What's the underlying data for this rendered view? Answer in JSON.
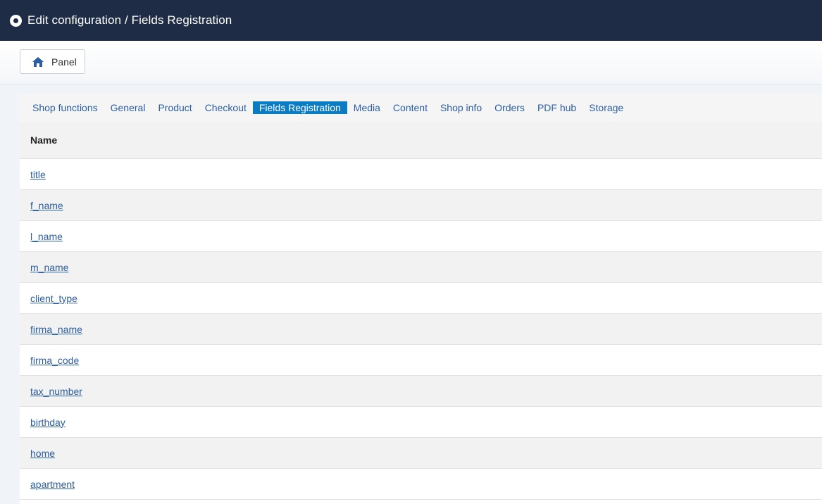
{
  "header": {
    "title": "Edit configuration / Fields Registration",
    "logo_icon": "record-icon"
  },
  "toolbar": {
    "panel_label": "Panel",
    "panel_icon": "home-icon"
  },
  "tabs": [
    {
      "label": "Shop functions",
      "active": false
    },
    {
      "label": "General",
      "active": false
    },
    {
      "label": "Product",
      "active": false
    },
    {
      "label": "Checkout",
      "active": false
    },
    {
      "label": "Fields Registration",
      "active": true
    },
    {
      "label": "Media",
      "active": false
    },
    {
      "label": "Content",
      "active": false
    },
    {
      "label": "Shop info",
      "active": false
    },
    {
      "label": "Orders",
      "active": false
    },
    {
      "label": "PDF hub",
      "active": false
    },
    {
      "label": "Storage",
      "active": false
    }
  ],
  "table": {
    "header_name": "Name",
    "rows": [
      "title",
      "f_name",
      "l_name",
      "m_name",
      "client_type",
      "firma_name",
      "firma_code",
      "tax_number",
      "birthday",
      "home",
      "apartment"
    ]
  },
  "colors": {
    "header_bg": "#1e2d45",
    "active_tab": "#0a7cc4",
    "link": "#2c5ea0"
  }
}
